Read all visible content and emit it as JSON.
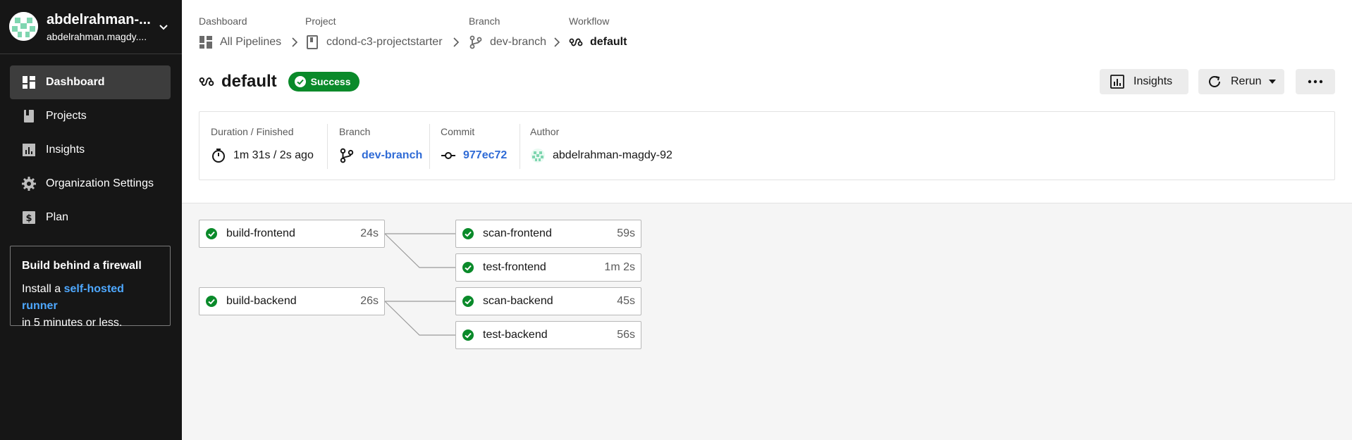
{
  "sidebar": {
    "user": {
      "name": "abdelrahman-...",
      "handle": "abdelrahman.magdy...."
    },
    "items": [
      {
        "label": "Dashboard",
        "icon": "dashboard-icon",
        "active": true
      },
      {
        "label": "Projects",
        "icon": "book-icon",
        "active": false
      },
      {
        "label": "Insights",
        "icon": "bar-chart-icon",
        "active": false
      },
      {
        "label": "Organization Settings",
        "icon": "gear-icon",
        "active": false
      },
      {
        "label": "Plan",
        "icon": "dollar-icon",
        "active": false
      }
    ],
    "promo": {
      "title": "Build behind a firewall",
      "text_before": "Install a ",
      "link": "self-hosted runner",
      "text_after": "in 5 minutes or less."
    }
  },
  "breadcrumbs": [
    {
      "label": "Dashboard",
      "value": "All Pipelines",
      "icon": "dashboard-icon"
    },
    {
      "label": "Project",
      "value": "cdond-c3-projectstarter",
      "icon": "book-icon"
    },
    {
      "label": "Branch",
      "value": "dev-branch",
      "icon": "branch-icon"
    },
    {
      "label": "Workflow",
      "value": "default",
      "icon": "workflow-icon"
    }
  ],
  "header": {
    "title": "default",
    "status": "Success",
    "insights_label": "Insights",
    "rerun_label": "Rerun"
  },
  "meta": {
    "duration": {
      "label": "Duration / Finished",
      "value": "1m 31s / 2s ago"
    },
    "branch": {
      "label": "Branch",
      "value": "dev-branch"
    },
    "commit": {
      "label": "Commit",
      "value": "977ec72"
    },
    "author": {
      "label": "Author",
      "value": "abdelrahman-magdy-92"
    }
  },
  "jobs": [
    {
      "name": "build-frontend",
      "duration": "24s"
    },
    {
      "name": "scan-frontend",
      "duration": "59s"
    },
    {
      "name": "test-frontend",
      "duration": "1m 2s"
    },
    {
      "name": "build-backend",
      "duration": "26s"
    },
    {
      "name": "scan-backend",
      "duration": "45s"
    },
    {
      "name": "test-backend",
      "duration": "56s"
    }
  ],
  "colors": {
    "success": "#0a8a2a",
    "link": "#2f6bd6",
    "sidebar_bg": "#161616"
  }
}
